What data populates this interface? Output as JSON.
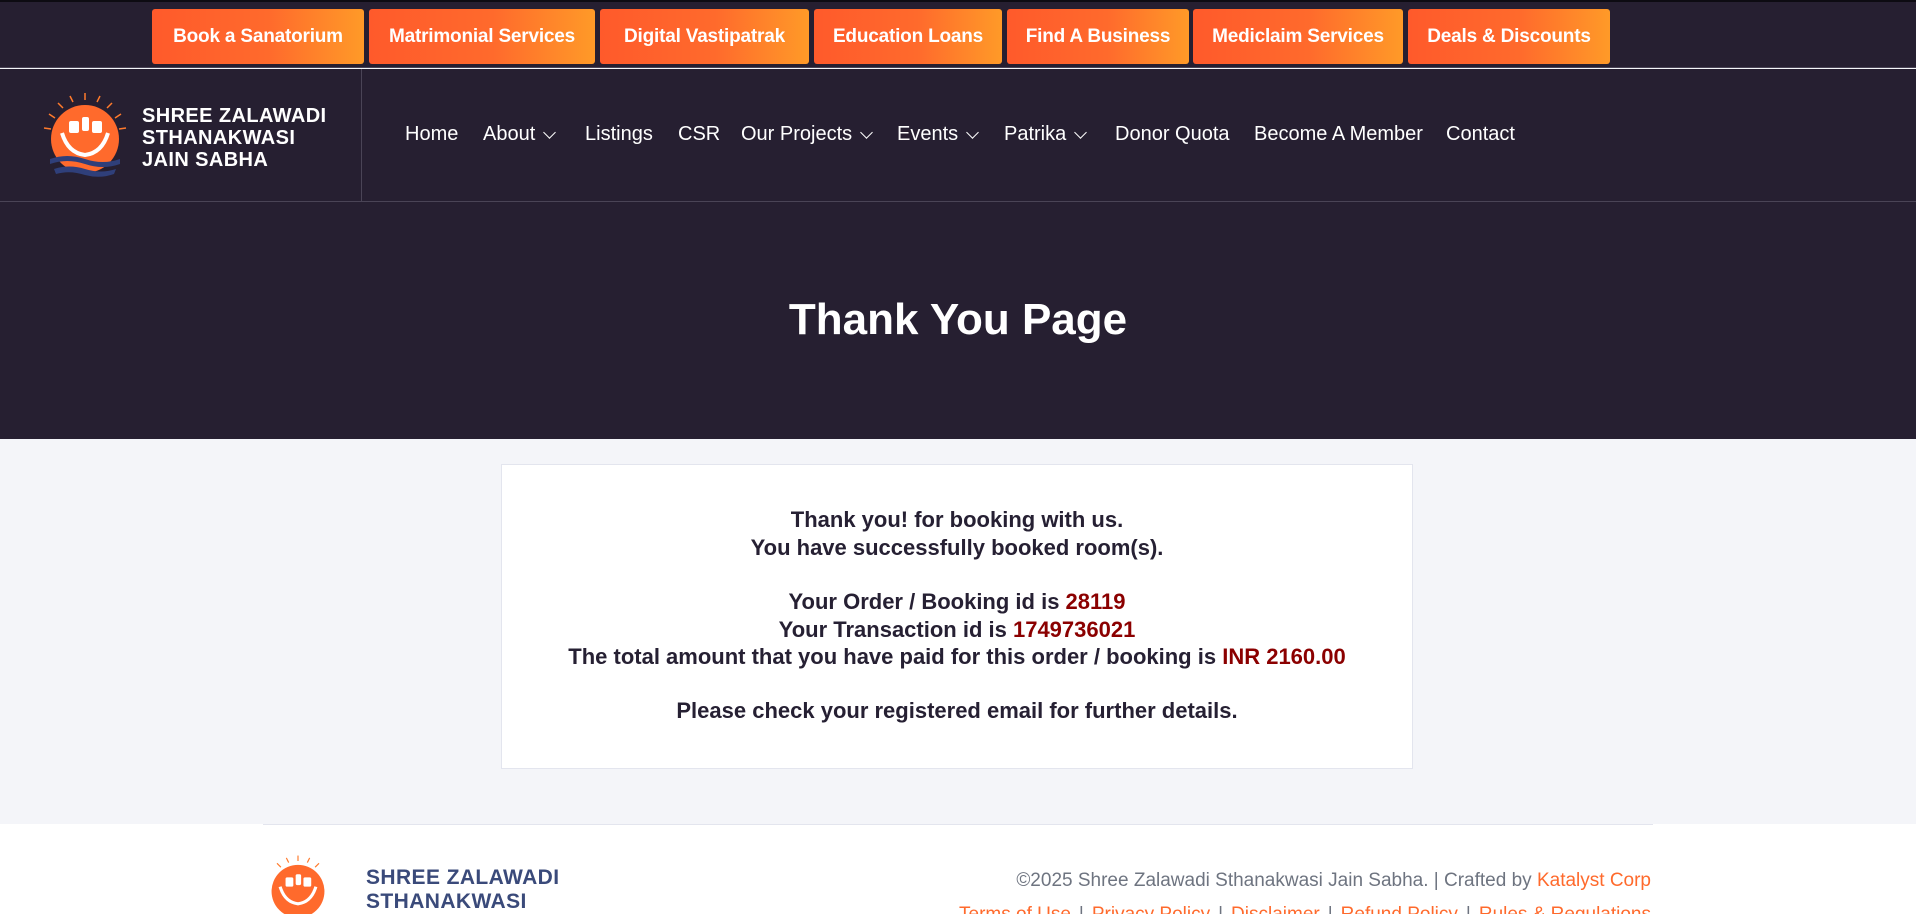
{
  "service_bar": {
    "buttons": [
      {
        "label": "Book a Sanatorium"
      },
      {
        "label": "Matrimonial Services"
      },
      {
        "label": "Digital Vastipatrak"
      },
      {
        "label": "Education Loans"
      },
      {
        "label": "Find A Business"
      },
      {
        "label": "Mediclaim Services"
      },
      {
        "label": "Deals & Discounts"
      }
    ],
    "gradient_from": "#ff5a2b",
    "gradient_to": "#ff9a28"
  },
  "logo": {
    "line1": "SHREE ZALAWADI",
    "line2": "STHANAKWASI",
    "line3": "JAIN SABHA"
  },
  "nav": {
    "items": [
      {
        "label": "Home",
        "dropdown": false
      },
      {
        "label": "About",
        "dropdown": true
      },
      {
        "label": "Listings",
        "dropdown": false
      },
      {
        "label": "CSR",
        "dropdown": false
      },
      {
        "label": "Our Projects",
        "dropdown": true
      },
      {
        "label": "Events",
        "dropdown": true
      },
      {
        "label": "Patrika",
        "dropdown": true
      },
      {
        "label": "Donor Quota",
        "dropdown": false
      },
      {
        "label": "Become A Member",
        "dropdown": false
      },
      {
        "label": "Contact",
        "dropdown": false
      }
    ]
  },
  "hero": {
    "title": "Thank You Page"
  },
  "confirmation": {
    "thanks": "Thank you! for booking with us.",
    "success": "You have successfully booked room(s).",
    "order_prefix": "Your Order / Booking id is ",
    "order_id": "28119",
    "txn_prefix": "Your Transaction id is ",
    "txn_id": "1749736021",
    "amount_prefix": "The total amount that you have paid for this order / booking is ",
    "amount": "INR 2160.00",
    "email_note": "Please check your registered email for further details."
  },
  "footer": {
    "logo_line1": "SHREE ZALAWADI",
    "logo_line2": "STHANAKWASI",
    "copyright": "©2025 Shree Zalawadi Sthanakwasi Jain Sabha. | Crafted by ",
    "crafted_by": "Katalyst Corp",
    "links": [
      "Terms of Use",
      "Privacy Policy",
      "Disclaimer",
      "Refund Policy",
      "Rules & Regulations"
    ]
  },
  "colors": {
    "dark_bg": "#261f31",
    "accent": "#ff6a2c",
    "value_red": "#8b0000",
    "page_bg": "#f4f5f9"
  }
}
